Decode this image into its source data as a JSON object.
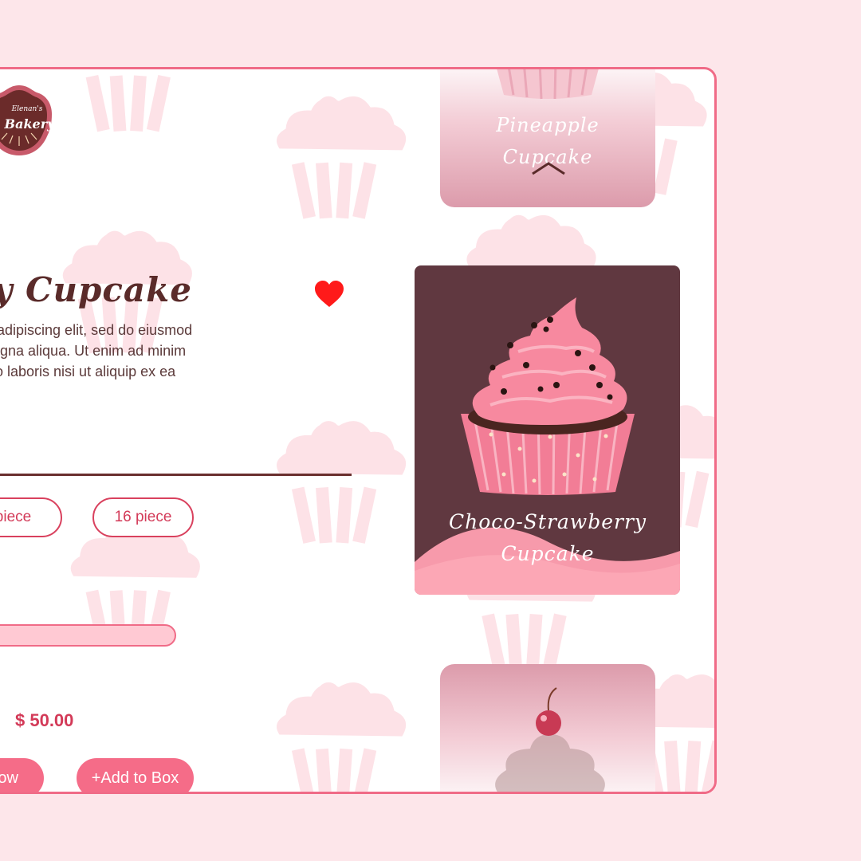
{
  "brand": {
    "logo_line1": "Elenan's",
    "logo_line2": "Bakery"
  },
  "product": {
    "title": "y Cupcake",
    "description": "ur adipiscing elit, sed do eiusmod\nmagna aliqua. Ut enim ad minim\nnco laboris nisi ut aliquip ex ea",
    "favorite_icon": "heart-icon",
    "favorited": true
  },
  "sizes": [
    {
      "label": "piece"
    },
    {
      "label": "16 piece"
    }
  ],
  "price": "$ 50.00",
  "actions": {
    "buy_label": "ow",
    "add_label": "+Add to Box"
  },
  "carousel": {
    "prev_card": {
      "label": "Pineapple Cupcake"
    },
    "current_card": {
      "label": "Choco-Strawberry Cupcake"
    },
    "next_card": {
      "label": ""
    },
    "up_icon": "chevron-up-icon",
    "down_icon": "chevron-down-icon"
  },
  "colors": {
    "background": "#fde6ea",
    "accent": "#f56c88",
    "brand_brown": "#5a2b2a",
    "card_dark": "#603840",
    "heart": "#ff1a1a"
  }
}
